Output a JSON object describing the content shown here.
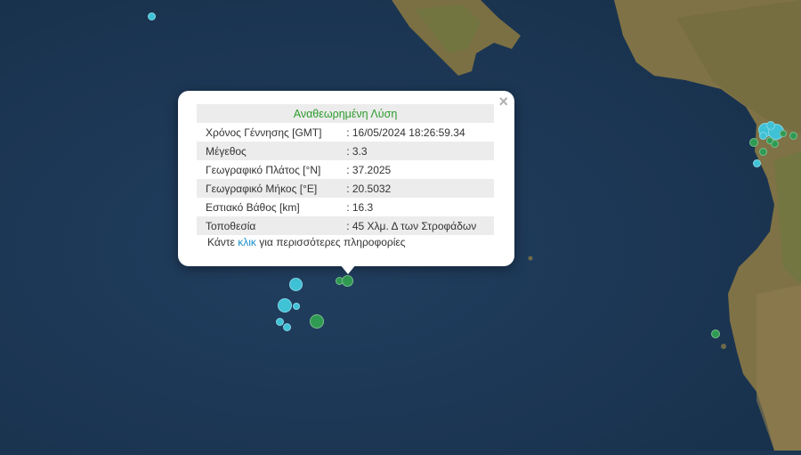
{
  "map": {
    "colors": {
      "sea": "#1c3552",
      "land": "#8a7a4c",
      "marker_cyan": "#3fc1d6",
      "marker_green": "#2f9a52"
    }
  },
  "popup": {
    "title": "Αναθεωρημένη Λύση",
    "rows": [
      {
        "label": "Χρόνος Γέννησης [GMT]",
        "value": ": 16/05/2024 18:26:59.34"
      },
      {
        "label": "Μέγεθος",
        "value": ": 3.3"
      },
      {
        "label": "Γεωγραφικό Πλάτος [°N]",
        "value": ": 37.2025"
      },
      {
        "label": "Γεωγραφικό Μήκος [°E]",
        "value": ": 20.5032"
      },
      {
        "label": "Εστιακό Βάθος [km]",
        "value": ": 16.3"
      },
      {
        "label": "Τοποθεσία",
        "value": ": 45 Χλμ. Δ των Στροφάδων"
      }
    ],
    "more_prefix": "Κάντε",
    "more_link": "κλικ",
    "more_suffix": "για περισσότερες πληροφορίες",
    "close_symbol": "×"
  }
}
